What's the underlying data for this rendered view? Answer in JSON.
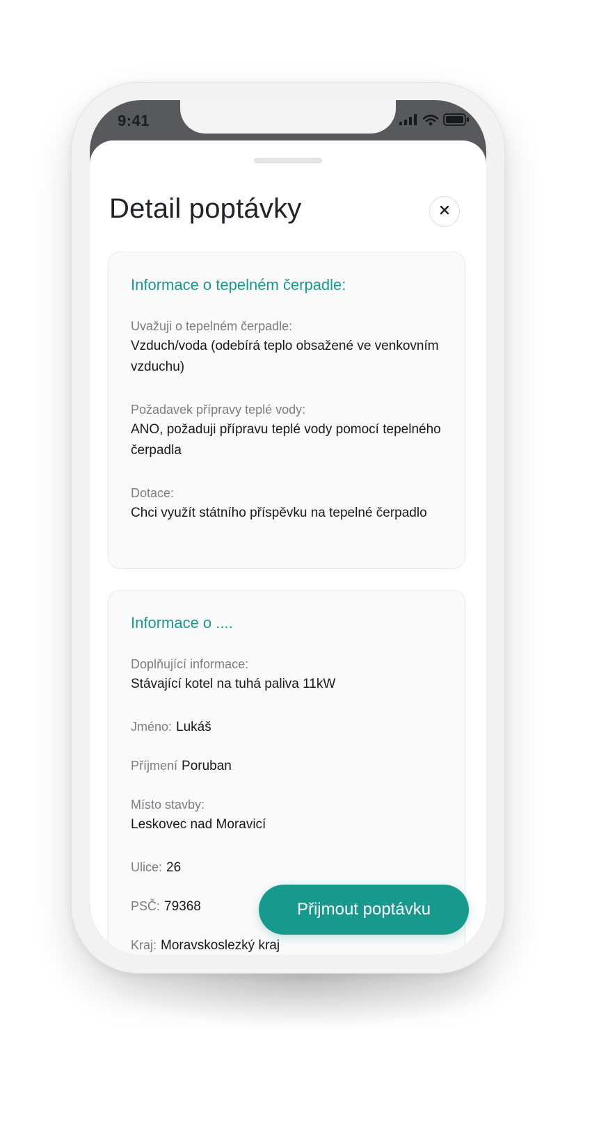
{
  "status_bar": {
    "time": "9:41",
    "icons": [
      "signal-icon",
      "wifi-icon",
      "battery-icon"
    ]
  },
  "header": {
    "title": "Detail poptávky",
    "close_icon": "close-icon",
    "close_label": "×"
  },
  "card1": {
    "title": "Informace o tepelném čerpadle:",
    "fields": [
      {
        "label": "Uvažuji o tepelném čerpadle:",
        "value": "Vzduch/voda (odebírá teplo obsažené ve venkovním vzduchu)"
      },
      {
        "label": "Požadavek přípravy teplé vody:",
        "value": "ANO, požaduji přípravu teplé vody pomocí tepelného čerpadla"
      },
      {
        "label": "Dotace:",
        "value": "Chci využít státního příspěvku na tepelné čerpadlo"
      }
    ]
  },
  "card2": {
    "title": "Informace o ....",
    "extra_info": {
      "label": "Doplňující informace:",
      "value": "Stávající kotel na tuhá paliva 11kW"
    },
    "first_name": {
      "label": "Jméno:",
      "value": "Lukáš"
    },
    "last_name": {
      "label": "Příjmení",
      "value": "Poruban"
    },
    "place": {
      "label": "Místo stavby:",
      "value": "Leskovec nad Moravicí"
    },
    "street": {
      "label": "Ulice:",
      "value": "26"
    },
    "zip": {
      "label": "PSČ:",
      "value": "79368"
    },
    "region": {
      "label": "Kraj:",
      "value": "Moravskoslezký kraj"
    }
  },
  "actions": {
    "accept_label": "Přijmout poptávku"
  },
  "colors": {
    "accent": "#179a8d",
    "text": "#17191c",
    "muted": "#7b7d82",
    "phone_top": "#57595d"
  }
}
